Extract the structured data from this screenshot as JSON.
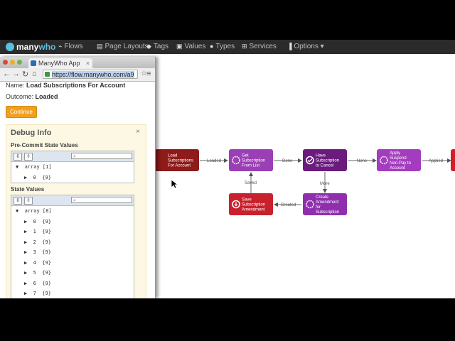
{
  "nav": {
    "logo_text": "many",
    "logo_accent": "who",
    "items": [
      {
        "label": "Flows",
        "icon": "flows-icon",
        "glyph": "⌁"
      },
      {
        "label": "Page Layouts",
        "icon": "page-layouts-icon",
        "glyph": "▤"
      },
      {
        "label": "Tags",
        "icon": "tags-icon",
        "glyph": "◆"
      },
      {
        "label": "Values",
        "icon": "values-icon",
        "glyph": "▣"
      },
      {
        "label": "Types",
        "icon": "types-icon",
        "glyph": "●"
      },
      {
        "label": "Services",
        "icon": "services-icon",
        "glyph": "⊞"
      },
      {
        "label": "Options ▾",
        "icon": "options-icon",
        "glyph": "▐"
      }
    ]
  },
  "popup": {
    "tab_title": "ManyWho App",
    "url_selected": "https://flow.manywho.com/a9",
    "name_label": "Name:",
    "name_value": "Load Subscriptions For Account",
    "outcome_label": "Outcome:",
    "outcome_value": "Loaded",
    "continue_label": "Continue",
    "debug": {
      "title": "Debug Info",
      "close": "×",
      "pre_commit_heading": "Pre-Commit State Values",
      "state_heading": "State Values",
      "pre_commit_nodes": [
        {
          "arrow": "▼",
          "text": "array [1]",
          "level": 0
        },
        {
          "arrow": "▶",
          "text": "0  {9}",
          "level": 1
        }
      ],
      "state_nodes": [
        {
          "arrow": "▼",
          "text": "array [8]",
          "level": 0
        },
        {
          "arrow": "▶",
          "text": "0  {9}",
          "level": 1
        },
        {
          "arrow": "▶",
          "text": "1  {9}",
          "level": 1
        },
        {
          "arrow": "▶",
          "text": "2  {9}",
          "level": 1
        },
        {
          "arrow": "▶",
          "text": "3  {9}",
          "level": 1
        },
        {
          "arrow": "▶",
          "text": "4  {9}",
          "level": 1
        },
        {
          "arrow": "▶",
          "text": "5  {9}",
          "level": 1
        },
        {
          "arrow": "▶",
          "text": "6  {9}",
          "level": 1
        },
        {
          "arrow": "▶",
          "text": "7  {9}",
          "level": 1
        }
      ]
    }
  },
  "flow": {
    "nodes": [
      {
        "id": "load",
        "label": [
          "Load",
          "Subscriptions",
          "For Account"
        ],
        "color": "#8e1a1a",
        "icon": "none"
      },
      {
        "id": "get",
        "label": [
          "Get",
          "Subscription",
          "From List"
        ],
        "color": "#9b3fb5",
        "icon": "gear"
      },
      {
        "id": "have",
        "label": [
          "Have",
          "Subscription",
          "to Cancel"
        ],
        "color": "#6a1b7d",
        "icon": "check"
      },
      {
        "id": "apply",
        "label": [
          "Apply",
          "Suspend",
          "Non-Pay to",
          "Account"
        ],
        "color": "#a43cbf",
        "icon": "gear"
      },
      {
        "id": "save",
        "label": [
          "Save",
          "Subscription",
          "Amendment"
        ],
        "color": "#c8202c",
        "icon": "save"
      },
      {
        "id": "create",
        "label": [
          "Create",
          "Amendment",
          "for",
          "Subscription"
        ],
        "color": "#8f2fae",
        "icon": "gear"
      },
      {
        "id": "edge",
        "label": [],
        "color": "#d11f2a",
        "icon": "none"
      }
    ],
    "edge_labels": {
      "loaded": "Loaded",
      "done": "Done",
      "none": "None",
      "applied": "Applied",
      "saved": "Saved",
      "more": "More",
      "created": "Created"
    }
  }
}
